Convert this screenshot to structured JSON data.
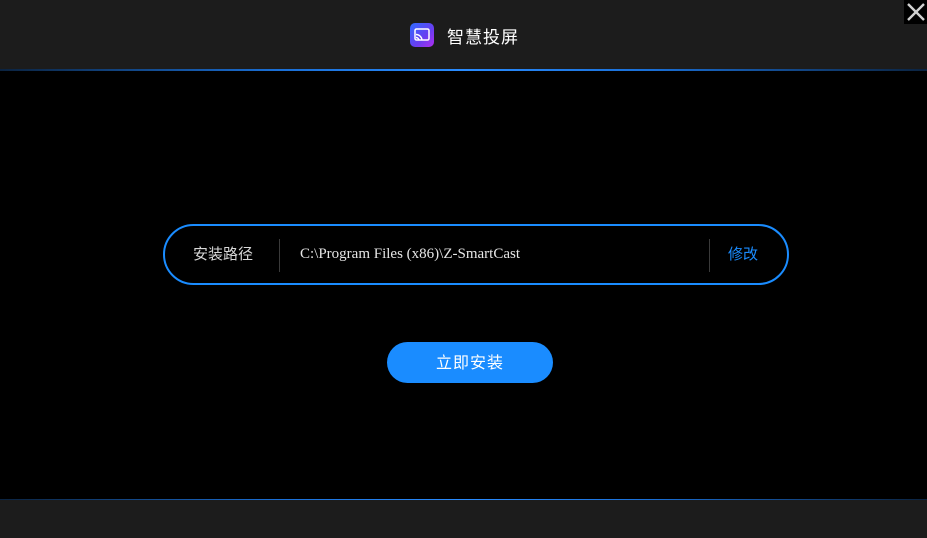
{
  "window": {
    "title": "智慧投屏",
    "app_icon": "cast-icon",
    "close_icon": "close-icon"
  },
  "install": {
    "path_label": "安装路径",
    "path_value": "C:\\Program Files (x86)\\Z-SmartCast",
    "modify_label": "修改",
    "install_button_label": "立即安装"
  },
  "colors": {
    "accent": "#1a8cff",
    "background": "#000000",
    "titlebar": "#1c1c1c"
  }
}
